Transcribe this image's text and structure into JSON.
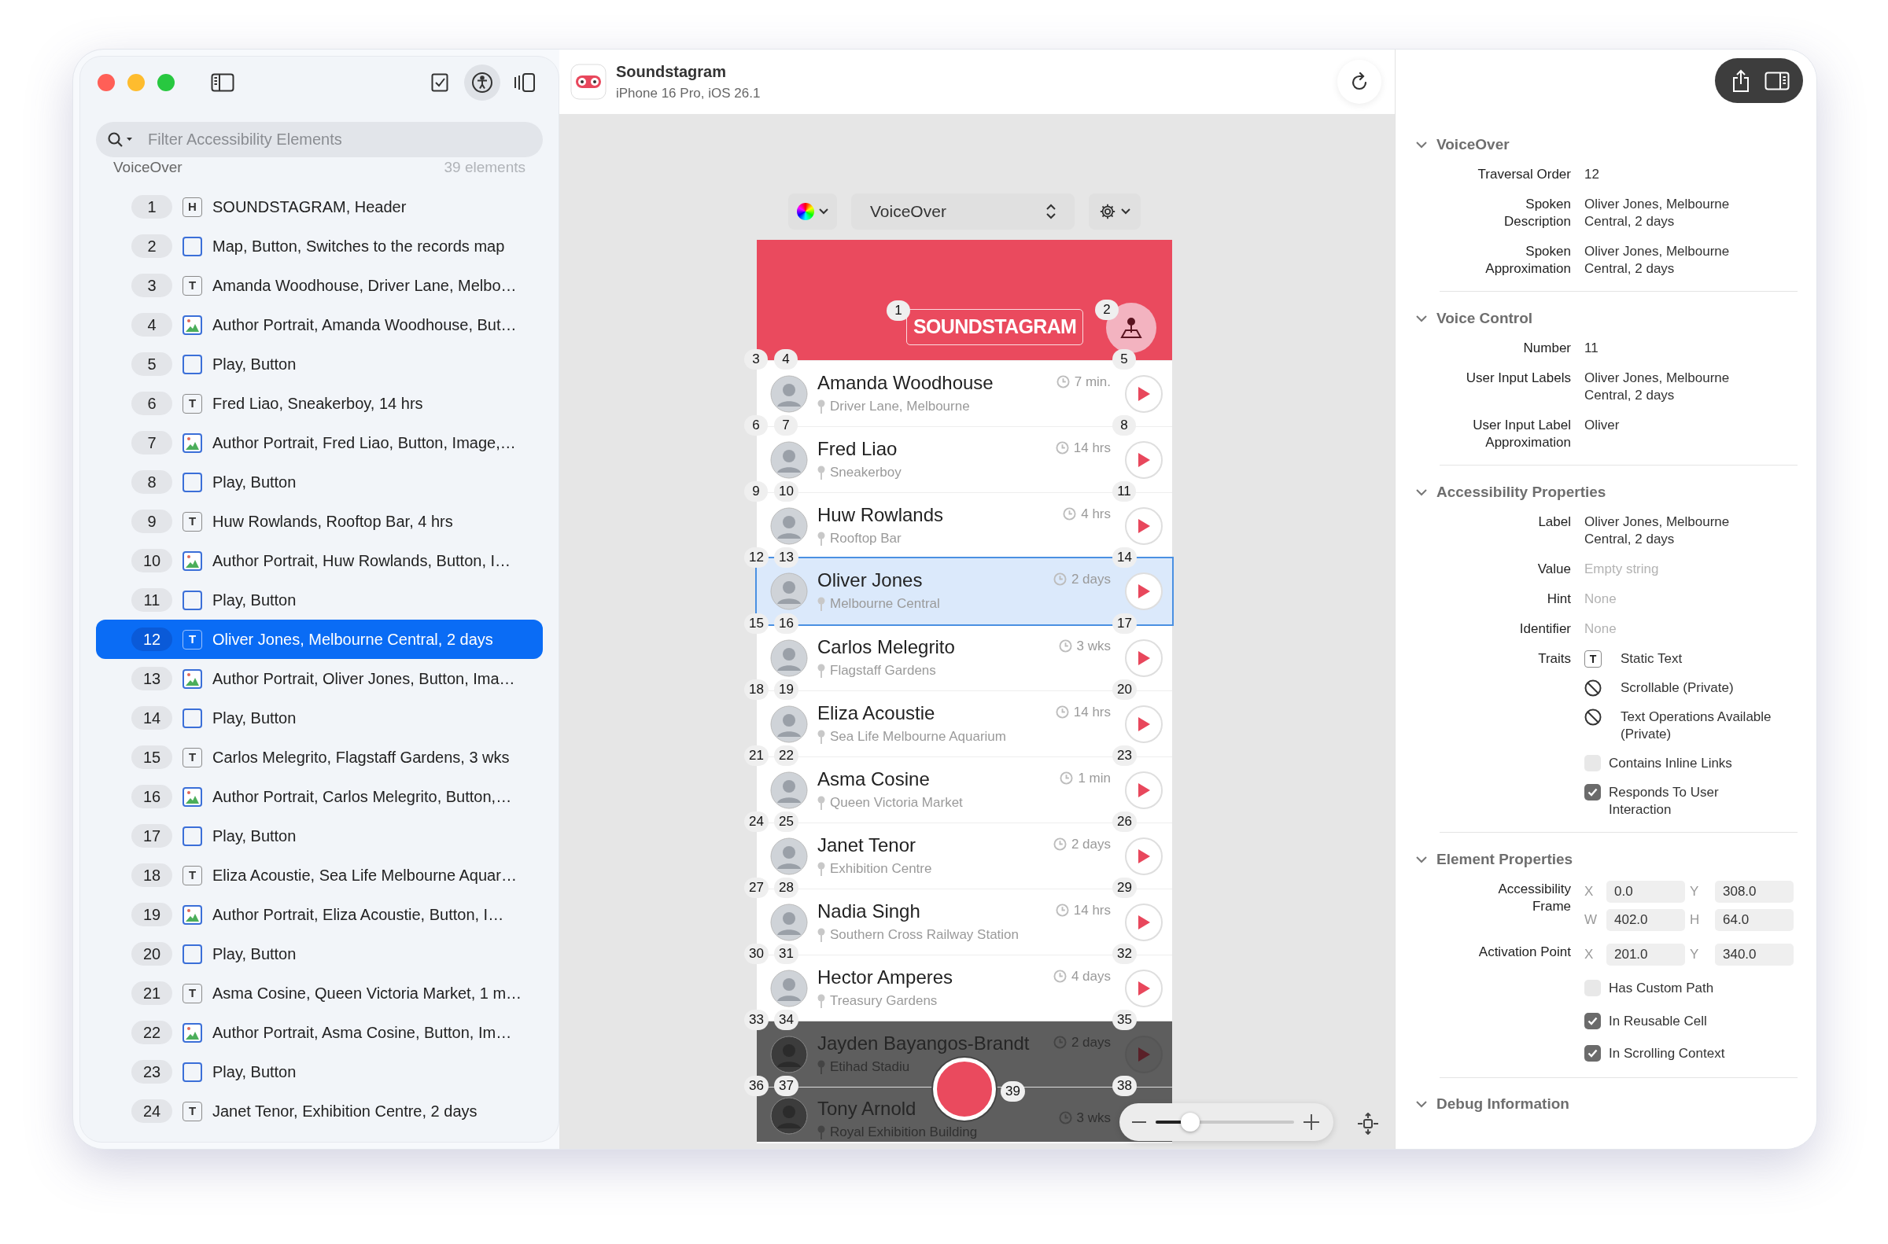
{
  "sidebar": {
    "toolbar_buttons": [
      {
        "kind": "checklist",
        "selected": false
      },
      {
        "kind": "accessibility",
        "selected": true
      },
      {
        "kind": "inspector",
        "selected": false
      }
    ],
    "search": {
      "placeholder": "Filter Accessibility Elements"
    },
    "mode": "VoiceOver",
    "count": "39 elements",
    "items": [
      {
        "number": "1",
        "kind": "header",
        "glyph": "H",
        "label": "SOUNDSTAGRAM, Header",
        "selected": false
      },
      {
        "number": "2",
        "kind": "button",
        "label": "Map, Button, Switches to the records map",
        "selected": false
      },
      {
        "number": "3",
        "kind": "text",
        "glyph": "T",
        "label": "Amanda Woodhouse, Driver Lane, Melbo…",
        "selected": false
      },
      {
        "number": "4",
        "kind": "image",
        "label": "Author Portrait, Amanda Woodhouse, But…",
        "selected": false
      },
      {
        "number": "5",
        "kind": "button",
        "label": "Play, Button",
        "selected": false
      },
      {
        "number": "6",
        "kind": "text",
        "glyph": "T",
        "label": "Fred Liao, Sneakerboy, 14 hrs",
        "selected": false
      },
      {
        "number": "7",
        "kind": "image",
        "label": "Author Portrait, Fred Liao, Button, Image,…",
        "selected": false
      },
      {
        "number": "8",
        "kind": "button",
        "label": "Play, Button",
        "selected": false
      },
      {
        "number": "9",
        "kind": "text",
        "glyph": "T",
        "label": "Huw Rowlands, Rooftop Bar, 4 hrs",
        "selected": false
      },
      {
        "number": "10",
        "kind": "image",
        "label": "Author Portrait, Huw Rowlands, Button, I…",
        "selected": false
      },
      {
        "number": "11",
        "kind": "button",
        "label": "Play, Button",
        "selected": false
      },
      {
        "number": "12",
        "kind": "text",
        "glyph": "T",
        "label": "Oliver Jones, Melbourne Central, 2 days",
        "selected": true
      },
      {
        "number": "13",
        "kind": "image",
        "label": "Author Portrait, Oliver Jones, Button, Ima…",
        "selected": false
      },
      {
        "number": "14",
        "kind": "button",
        "label": "Play, Button",
        "selected": false
      },
      {
        "number": "15",
        "kind": "text",
        "glyph": "T",
        "label": "Carlos Melegrito, Flagstaff Gardens, 3 wks",
        "selected": false
      },
      {
        "number": "16",
        "kind": "image",
        "label": "Author Portrait, Carlos Melegrito, Button,…",
        "selected": false
      },
      {
        "number": "17",
        "kind": "button",
        "label": "Play, Button",
        "selected": false
      },
      {
        "number": "18",
        "kind": "text",
        "glyph": "T",
        "label": "Eliza Acoustie, Sea Life Melbourne Aquar…",
        "selected": false
      },
      {
        "number": "19",
        "kind": "image",
        "label": "Author Portrait, Eliza Acoustie, Button, I…",
        "selected": false
      },
      {
        "number": "20",
        "kind": "button",
        "label": "Play, Button",
        "selected": false
      },
      {
        "number": "21",
        "kind": "text",
        "glyph": "T",
        "label": "Asma Cosine, Queen Victoria Market, 1 m…",
        "selected": false
      },
      {
        "number": "22",
        "kind": "image",
        "label": "Author Portrait, Asma Cosine, Button, Im…",
        "selected": false
      },
      {
        "number": "23",
        "kind": "button",
        "label": "Play, Button",
        "selected": false
      },
      {
        "number": "24",
        "kind": "text",
        "glyph": "T",
        "label": "Janet Tenor, Exhibition Centre, 2 days",
        "selected": false
      }
    ]
  },
  "app_bar": {
    "app_name": "Soundstagram",
    "device": "iPhone 16 Pro, iOS 26.1"
  },
  "simulator": {
    "mode": "VoiceOver",
    "header": {
      "logo": "SOUNDSTAGRAM",
      "logo_badge": "1",
      "map_badge": "2"
    },
    "rows": [
      {
        "name": "Amanda Woodhouse",
        "place": "Driver Lane, Melbourne",
        "time": "7 min.",
        "badges": [
          "3",
          "4",
          "5"
        ],
        "selected": false,
        "dimmed": false,
        "play_button": true
      },
      {
        "name": "Fred Liao",
        "place": "Sneakerboy",
        "time": "14 hrs",
        "badges": [
          "6",
          "7",
          "8"
        ],
        "selected": false,
        "dimmed": false,
        "play_button": true
      },
      {
        "name": "Huw Rowlands",
        "place": "Rooftop Bar",
        "time": "4 hrs",
        "badges": [
          "9",
          "10",
          "11"
        ],
        "selected": false,
        "dimmed": false,
        "play_button": true
      },
      {
        "name": "Oliver Jones",
        "place": "Melbourne Central",
        "time": "2 days",
        "badges": [
          "12",
          "13",
          "14"
        ],
        "selected": true,
        "dimmed": false,
        "play_button": true
      },
      {
        "name": "Carlos Melegrito",
        "place": "Flagstaff Gardens",
        "time": "3 wks",
        "badges": [
          "15",
          "16",
          "17"
        ],
        "selected": false,
        "dimmed": false,
        "play_button": true
      },
      {
        "name": "Eliza Acoustie",
        "place": "Sea Life Melbourne Aquarium",
        "time": "14 hrs",
        "badges": [
          "18",
          "19",
          "20"
        ],
        "selected": false,
        "dimmed": false,
        "play_button": true
      },
      {
        "name": "Asma Cosine",
        "place": "Queen Victoria Market",
        "time": "1 min",
        "badges": [
          "21",
          "22",
          "23"
        ],
        "selected": false,
        "dimmed": false,
        "play_button": true
      },
      {
        "name": "Janet Tenor",
        "place": "Exhibition Centre",
        "time": "2 days",
        "badges": [
          "24",
          "25",
          "26"
        ],
        "selected": false,
        "dimmed": false,
        "play_button": true
      },
      {
        "name": "Nadia Singh",
        "place": "Southern Cross Railway Station",
        "time": "14 hrs",
        "badges": [
          "27",
          "28",
          "29"
        ],
        "selected": false,
        "dimmed": false,
        "play_button": true
      },
      {
        "name": "Hector Amperes",
        "place": "Treasury Gardens",
        "time": "4 days",
        "badges": [
          "30",
          "31",
          "32"
        ],
        "selected": false,
        "dimmed": false,
        "play_button": true
      },
      {
        "name": "Jayden Bayangos-Brandt",
        "place": "Etihad Stadiu",
        "time": "2 days",
        "badges": [
          "33",
          "34",
          "35"
        ],
        "selected": false,
        "dimmed": true,
        "play_button": true
      },
      {
        "name": "Tony Arnold",
        "place": "Royal Exhibition Building",
        "time": "3 wks",
        "badges": [
          "36",
          "37",
          "38"
        ],
        "selected": false,
        "dimmed": true,
        "play_button": false
      }
    ],
    "record_badge": "39",
    "zoom": {
      "level": 0.25
    }
  },
  "inspector": {
    "sections": [
      {
        "title": "VoiceOver",
        "expanded": true,
        "rows": [
          {
            "kind": "text",
            "label": "Traversal Order",
            "value": "12"
          },
          {
            "kind": "text",
            "label": "Spoken Description",
            "value": "Oliver Jones, Melbourne Central, 2 days"
          },
          {
            "kind": "text",
            "label": "Spoken Approximation",
            "value": "Oliver Jones, Melbourne Central, 2 days"
          }
        ]
      },
      {
        "title": "Voice Control",
        "expanded": true,
        "rows": [
          {
            "kind": "text",
            "label": "Number",
            "value": "11"
          },
          {
            "kind": "text",
            "label": "User Input Labels",
            "value": "Oliver Jones, Melbourne Central, 2 days"
          },
          {
            "kind": "text",
            "label": "User Input Label Approximation",
            "value": "Oliver"
          }
        ]
      },
      {
        "title": "Accessibility Properties",
        "expanded": true,
        "rows": [
          {
            "kind": "text",
            "label": "Label",
            "value": "Oliver Jones, Melbourne Central, 2 days"
          },
          {
            "kind": "muted",
            "label": "Value",
            "value": "Empty string"
          },
          {
            "kind": "muted",
            "label": "Hint",
            "value": "None"
          },
          {
            "kind": "muted",
            "label": "Identifier",
            "value": "None"
          },
          {
            "kind": "traits",
            "label": "Traits",
            "items": [
              {
                "kind": "trait",
                "glyph": "T",
                "label": "Static Text"
              },
              {
                "kind": "unavailable",
                "label": "Scrollable (Private)"
              },
              {
                "kind": "unavailable",
                "label": "Text Operations Available (Private)"
              },
              {
                "kind": "checkbox",
                "label": "Contains Inline Links",
                "checked": false
              },
              {
                "kind": "checkbox",
                "label": "Responds To User Interaction",
                "checked": true
              }
            ]
          }
        ]
      },
      {
        "title": "Element Properties",
        "expanded": true,
        "rows": [
          {
            "kind": "coords",
            "label": "Accessibility Frame",
            "fields": [
              {
                "axis": "X",
                "value": "0.0"
              },
              {
                "axis": "Y",
                "value": "308.0"
              },
              {
                "axis": "W",
                "value": "402.0"
              },
              {
                "axis": "H",
                "value": "64.0"
              }
            ]
          },
          {
            "kind": "coords",
            "label": "Activation Point",
            "fields": [
              {
                "axis": "X",
                "value": "201.0"
              },
              {
                "axis": "Y",
                "value": "340.0"
              }
            ]
          },
          {
            "kind": "checks",
            "items": [
              {
                "label": "Has Custom Path",
                "checked": false
              },
              {
                "label": "In Reusable Cell",
                "checked": true
              },
              {
                "label": "In Scrolling Context",
                "checked": true
              }
            ]
          }
        ]
      },
      {
        "title": "Debug Information",
        "expanded": true
      }
    ]
  }
}
